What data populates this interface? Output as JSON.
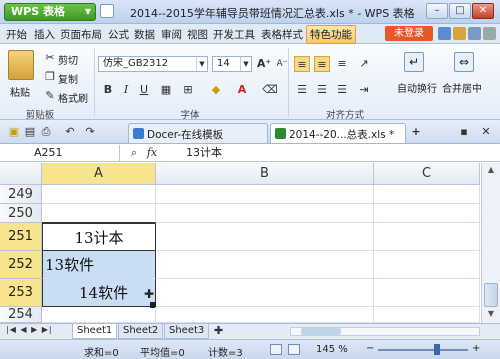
{
  "app": {
    "wps_button": "WPS 表格",
    "title": "2014--2015学年辅导员带班情况汇总表.xls * - WPS 表格"
  },
  "menu": {
    "items": [
      "开始",
      "插入",
      "页面布局",
      "公式",
      "数据",
      "审阅",
      "视图",
      "开发工具",
      "表格样式"
    ],
    "special": "特色功能",
    "login": "未登录"
  },
  "ribbon": {
    "paste": "粘贴",
    "cut": "剪切",
    "copy": "复制",
    "format_painter": "格式刷",
    "clipboard_group": "剪贴板",
    "font_name": "仿宋_GB2312",
    "font_size": "14",
    "bold": "B",
    "italic": "I",
    "underline": "U",
    "font_group": "字体",
    "align_group": "对齐方式",
    "wrap_text": "自动换行",
    "merge_center": "合并居中"
  },
  "tabs": {
    "docer": "Docer-在线模板",
    "doc": "2014--20...总表.xls *"
  },
  "formula_bar": {
    "name_box": "A251",
    "fx": "fx",
    "content": "13计本"
  },
  "grid": {
    "columns": [
      "A",
      "B",
      "C"
    ],
    "rows": [
      {
        "num": "249",
        "a": ""
      },
      {
        "num": "250",
        "a": ""
      },
      {
        "num": "251",
        "a": "13计本"
      },
      {
        "num": "252",
        "a": "13软件"
      },
      {
        "num": "253",
        "a": "14软件"
      },
      {
        "num": "254",
        "a": ""
      }
    ]
  },
  "sheets": [
    "Sheet1",
    "Sheet2",
    "Sheet3"
  ],
  "status": {
    "sum": "求和=0",
    "avg": "平均值=0",
    "count": "计数=3",
    "zoom": "145 %"
  },
  "colors": {
    "selected_row_header": "#f7e48f",
    "selected_cell": "#c9def5",
    "login": "#e8572a",
    "wps_green": "#3b9a24"
  }
}
